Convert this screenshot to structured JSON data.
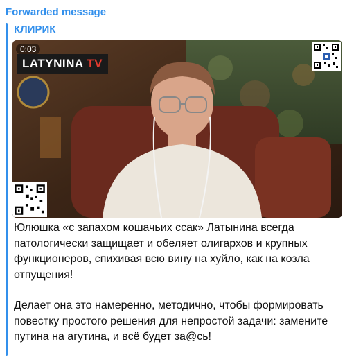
{
  "message": {
    "forwarded_label": "Forwarded message",
    "channel_name": "КЛИРИК",
    "video": {
      "duration": "0:03",
      "logo_main": "LATYNINA",
      "logo_tv": "TV"
    },
    "paragraphs": [
      "Юлюшка «с запахом кошачьих ссак» Латынина всегда патологически защищает и обеляет олигархов и крупных функционеров, спихивая всю вину на хуйло, как на козла отпущения!",
      "Делает она это намеренно, методично, чтобы формировать повестку простого решения для непростой задачи: замените путина на агутина, и всё будет за@сь!"
    ]
  },
  "colors": {
    "accent": "#3390ec",
    "text": "#111111"
  }
}
